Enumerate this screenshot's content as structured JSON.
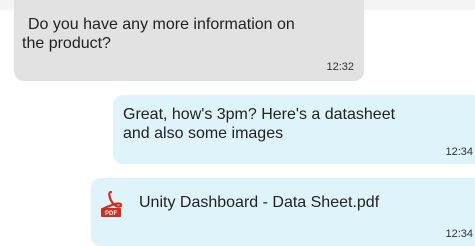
{
  "messages": [
    {
      "direction": "incoming",
      "text": "Do you have any more information on the product?",
      "line1": "Do you have any more information on",
      "line2": "the product?",
      "time": "12:32"
    },
    {
      "direction": "outgoing",
      "line1": "Great, how's 3pm? Here's a datasheet",
      "line2": "and also some images",
      "time": "12:34"
    },
    {
      "direction": "outgoing",
      "type": "attachment",
      "icon": "pdf-file-icon",
      "icon_label": "PDF",
      "filename": "Unity Dashboard - Data Sheet.pdf",
      "time": "12:34"
    }
  ],
  "colors": {
    "incoming_bubble": "#e2e2e2",
    "outgoing_bubble": "#dff3fb",
    "pdf_red": "#d62b22"
  }
}
